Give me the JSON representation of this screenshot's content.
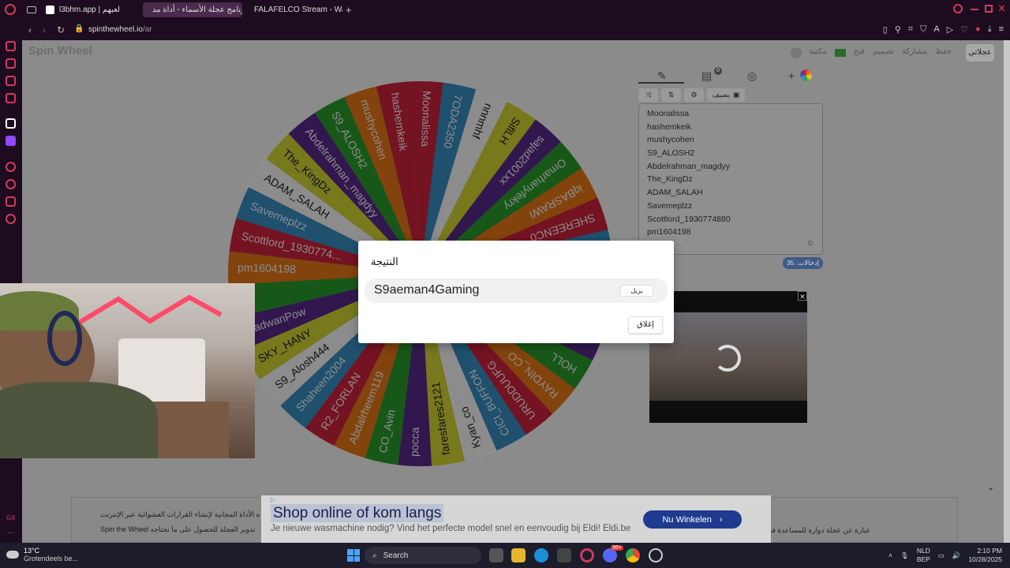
{
  "browser": {
    "tabs": [
      {
        "title": "l3bhm.app | لعبهم",
        "active": false
      },
      {
        "title": "برنامج عجلة الأسماء - أداة مد...",
        "active": true
      },
      {
        "title": "FALAFELCO Stream - Wat",
        "active": false
      }
    ],
    "new_tab": "+",
    "url_domain": "spinthewheel.io",
    "url_path": "/ar"
  },
  "site": {
    "logo": "Spin Wheel",
    "header_links": [
      "حفظ",
      "مشاركة",
      "تصميم",
      "فتح",
      "مكتبة"
    ],
    "my_wheels": "عجلاتي",
    "add_label": "يضيف",
    "entries": [
      "Moonalissa",
      "hashemkeik",
      "mushycohen",
      "S9_ALOSH2",
      "Abdelrahman_magdyy",
      "The_KingDz",
      "ADAM_SALAH",
      "Savemeplzz",
      "Scottlord_1930774880",
      "pm1604198"
    ],
    "entries_count": "إدخالات: 35",
    "badge_count": "0"
  },
  "wheel": {
    "segments": [
      {
        "label": "Moonalissa",
        "color": "#d3233e"
      },
      {
        "label": "7ODA2350",
        "color": "#3a93c8"
      },
      {
        "label": "nnnmhf",
        "color": "#ffffff"
      },
      {
        "label": "SiflLH",
        "color": "#d9dc34"
      },
      {
        "label": "sajad2001xx",
        "color": "#5b2b8f"
      },
      {
        "label": "Omarhanyfekry",
        "color": "#2aa02e"
      },
      {
        "label": "iqBASRAWI",
        "color": "#ee7a17"
      },
      {
        "label": "SHEREENC0",
        "color": "#d3233e"
      },
      {
        "label": "",
        "color": "#3a93c8"
      },
      {
        "label": "",
        "color": "#ffffff"
      },
      {
        "label": "",
        "color": "#d9dc34"
      },
      {
        "label": "",
        "color": "#5b2b8f"
      },
      {
        "label": "HOLL",
        "color": "#2aa02e"
      },
      {
        "label": "RAYDIN_CO",
        "color": "#ee7a17"
      },
      {
        "label": "URUDDUUFG",
        "color": "#d3233e"
      },
      {
        "label": "CICI_BUFFON",
        "color": "#3a93c8"
      },
      {
        "label": "Kyan_co",
        "color": "#ffffff"
      },
      {
        "label": "faresfares2121",
        "color": "#d9dc34"
      },
      {
        "label": "pocca",
        "color": "#5b2b8f"
      },
      {
        "label": "CO_Avin",
        "color": "#2aa02e"
      },
      {
        "label": "Abdalrheem119",
        "color": "#ee7a17"
      },
      {
        "label": "R2_FORLAN",
        "color": "#d3233e"
      },
      {
        "label": "Shaheen2004",
        "color": "#3a93c8"
      },
      {
        "label": "S9_Alosh444",
        "color": "#ffffff"
      },
      {
        "label": "SKY_HANY",
        "color": "#d9dc34"
      },
      {
        "label": "RadwanPow",
        "color": "#5b2b8f"
      },
      {
        "label": "",
        "color": "#2aa02e"
      },
      {
        "label": "pm1604198",
        "color": "#ee7a17"
      },
      {
        "label": "Scottlord_1930774...",
        "color": "#d3233e"
      },
      {
        "label": "Savemeplzz",
        "color": "#3a93c8"
      },
      {
        "label": "ADAM_SALAH",
        "color": "#ffffff"
      },
      {
        "label": "The_KingDz",
        "color": "#d9dc34"
      },
      {
        "label": "Abdelrahman_magdyy",
        "color": "#5b2b8f"
      },
      {
        "label": "S9_ALOSH2",
        "color": "#2aa02e"
      },
      {
        "label": "mushycohen",
        "color": "#ee7a17"
      },
      {
        "label": "hashemkeik",
        "color": "#d3233e"
      }
    ]
  },
  "ad": {
    "mark": "▷",
    "title": "Shop online of kom langs",
    "body": "Je nieuwe wasmachine nodig? Vind het perfecte model snel en eenvoudig bij Eldi! Eldi.be",
    "cta": "Nu Winkelen",
    "cta_icon": "›"
  },
  "footer": {
    "line1": "ه الأداة المجانية لإنشاء القرارات العشوائية عبر الإنترنت",
    "line2": "Spin the Wheel تدوير العجلة للحصول على ما تحتاجه",
    "line3": "عبارة عن عجلة دوارة للمساعدة في"
  },
  "modal": {
    "title": "النتيجة",
    "winner": "S9aeman4Gaming",
    "remove": "يزيل",
    "close": "إغلاق"
  },
  "taskbar": {
    "temp": "13°C",
    "weather": "Grotendeels be...",
    "search": "Search",
    "lang1": "NLD",
    "lang2": "BEP",
    "time": "2:10 PM",
    "date": "10/28/2025",
    "badge": "99+"
  }
}
